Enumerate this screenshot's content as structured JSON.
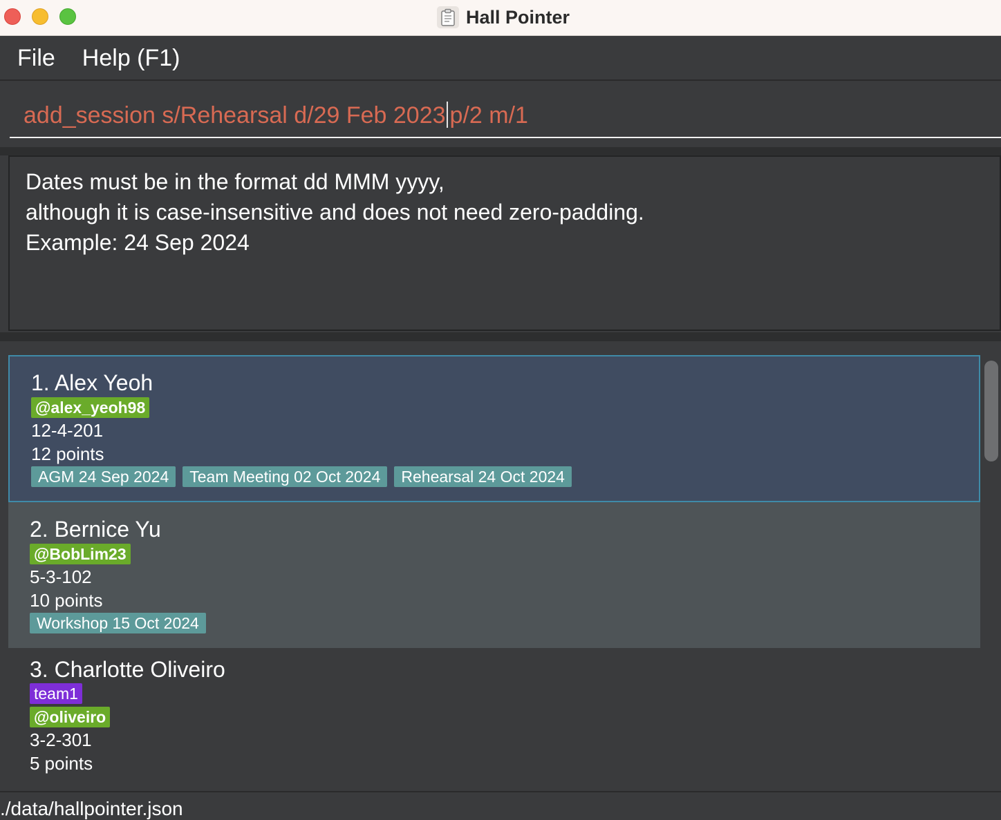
{
  "window": {
    "title": "Hall Pointer"
  },
  "menu": {
    "file": "File",
    "help": "Help (F1)"
  },
  "command": {
    "before_caret": "add_session s/Rehearsal d/29 Feb 2023",
    "after_caret": "p/2 m/1"
  },
  "result": {
    "lines": [
      "Dates must be in the format dd MMM yyyy,",
      "although it is case-insensitive and does not need zero-padding.",
      "Example: 24 Sep 2024"
    ]
  },
  "persons": [
    {
      "name": "1. Alex Yeoh",
      "telegram": "@alex_yeoh98",
      "room": "12-4-201",
      "points": "12 points",
      "sessions": [
        "AGM 24 Sep 2024",
        "Team Meeting 02 Oct 2024",
        "Rehearsal 24 Oct 2024"
      ]
    },
    {
      "name": "2. Bernice Yu",
      "telegram": "@BobLim23",
      "room": "5-3-102",
      "points": "10 points",
      "sessions": [
        "Workshop 15 Oct 2024"
      ]
    },
    {
      "name": "3. Charlotte Oliveiro",
      "tag": "team1",
      "telegram": "@oliveiro",
      "room": "3-2-301",
      "points": "5 points"
    }
  ],
  "status": {
    "path": "./data/hallpointer.json"
  },
  "colors": {
    "command_error_text": "#d86a53",
    "selected_card": "#404c61",
    "telegram_chip": "#6aab2a",
    "tag_chip": "#7e2ed8",
    "session_chip": "#5d9a9a"
  },
  "icons": {
    "app": "clipboard-icon"
  }
}
